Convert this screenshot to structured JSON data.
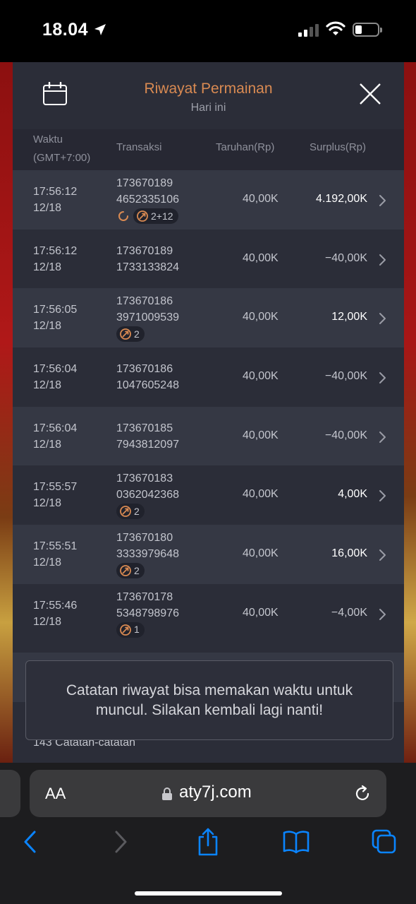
{
  "status_bar": {
    "time": "18.04"
  },
  "modal": {
    "title": "Riwayat Permainan",
    "subtitle": "Hari ini",
    "columns": {
      "time_line1": "Waktu",
      "time_line2": "(GMT+7:00)",
      "transaction": "Transaksi",
      "bet": "Taruhan(Rp)",
      "surplus": "Surplus(Rp)"
    },
    "rows": [
      {
        "time": "17:56:12",
        "date": "12/18",
        "id1": "173670189",
        "id2": "4652335106",
        "bet": "40,00K",
        "surplus": "4.192,00K",
        "badge": "2+12",
        "spin": true
      },
      {
        "time": "17:56:12",
        "date": "12/18",
        "id1": "173670189",
        "id2": "1733133824",
        "bet": "40,00K",
        "surplus": "−40,00K",
        "badge": "",
        "spin": false
      },
      {
        "time": "17:56:05",
        "date": "12/18",
        "id1": "173670186",
        "id2": "3971009539",
        "bet": "40,00K",
        "surplus": "12,00K",
        "badge": "2",
        "spin": false
      },
      {
        "time": "17:56:04",
        "date": "12/18",
        "id1": "173670186",
        "id2": "1047605248",
        "bet": "40,00K",
        "surplus": "−40,00K",
        "badge": "",
        "spin": false
      },
      {
        "time": "17:56:04",
        "date": "12/18",
        "id1": "173670185",
        "id2": "7943812097",
        "bet": "40,00K",
        "surplus": "−40,00K",
        "badge": "",
        "spin": false
      },
      {
        "time": "17:55:57",
        "date": "12/18",
        "id1": "173670183",
        "id2": "0362042368",
        "bet": "40,00K",
        "surplus": "4,00K",
        "badge": "2",
        "spin": false
      },
      {
        "time": "17:55:51",
        "date": "12/18",
        "id1": "173670180",
        "id2": "3333979648",
        "bet": "40,00K",
        "surplus": "16,00K",
        "badge": "2",
        "spin": false
      },
      {
        "time": "17:55:46",
        "date": "12/18",
        "id1": "173670178",
        "id2": "5348798976",
        "bet": "40,00K",
        "surplus": "−4,00K",
        "badge": "1",
        "spin": false
      }
    ],
    "record_count": "143 Catatan-catatan"
  },
  "toast": {
    "message": "Catatan riwayat bisa memakan waktu untuk muncul. Silakan kembali lagi nanti!"
  },
  "browser": {
    "aa_label": "AA",
    "url": "aty7j.com"
  },
  "colors": {
    "accent": "#d98a52",
    "modal_bg": "#2b2d38",
    "row_alt_bg": "#353844",
    "ios_blue": "#0a84ff"
  },
  "icons": [
    "location-arrow-icon",
    "signal-icon",
    "wifi-icon",
    "battery-icon",
    "calendar-icon",
    "close-icon",
    "chevron-right-icon",
    "spin-icon",
    "free-spin-icon",
    "lock-icon",
    "reload-icon",
    "back-icon",
    "forward-icon",
    "share-icon",
    "bookmarks-icon",
    "tabs-icon"
  ]
}
